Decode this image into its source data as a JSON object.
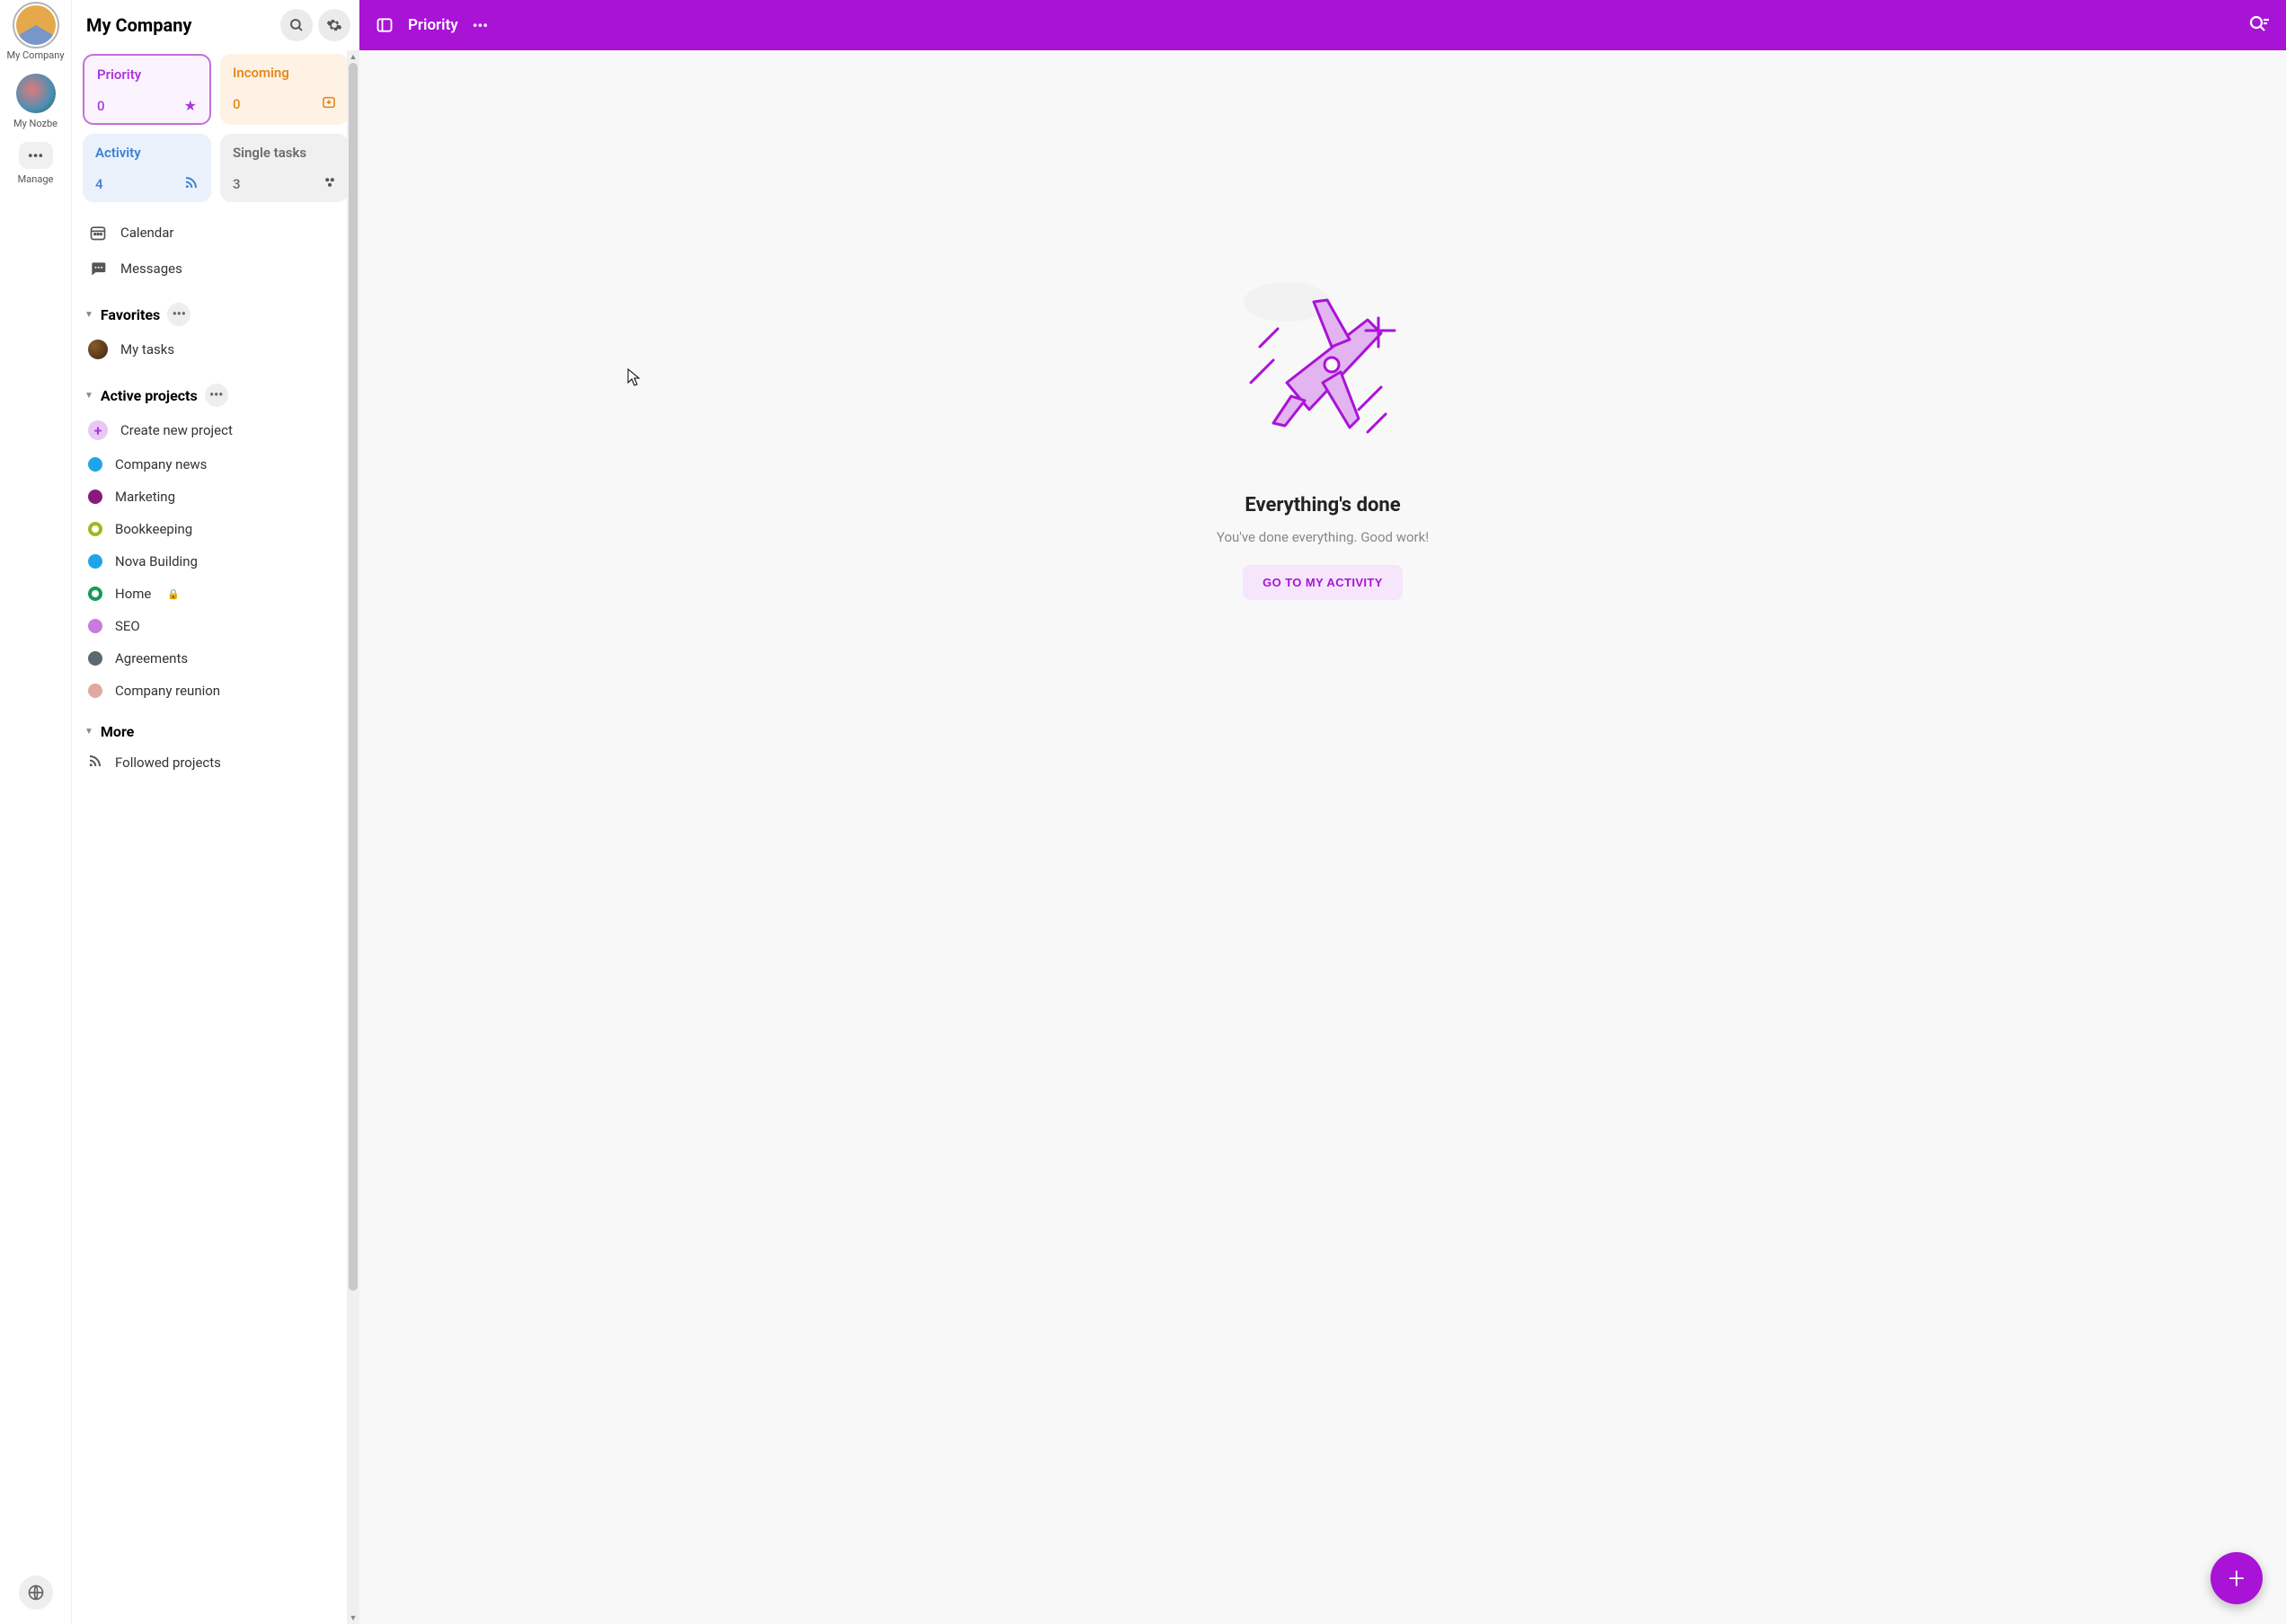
{
  "rail": {
    "workspaces": [
      {
        "label": "My Company",
        "selected": true,
        "bg": "conic-gradient(#e5a84a 0 120deg, #7797c9 120deg 240deg, #e5a84a 240deg)"
      },
      {
        "label": "My Nozbe",
        "selected": false,
        "bg": "radial-gradient(circle at 40% 40%, #e07a7a, #4a8fb5 60%, #2d5a3a)"
      }
    ],
    "manage_label": "Manage"
  },
  "sidebar": {
    "title": "My Company",
    "tiles": {
      "priority": {
        "title": "Priority",
        "count": "0"
      },
      "incoming": {
        "title": "Incoming",
        "count": "0"
      },
      "activity": {
        "title": "Activity",
        "count": "4"
      },
      "single": {
        "title": "Single tasks",
        "count": "3"
      }
    },
    "links": {
      "calendar": "Calendar",
      "messages": "Messages"
    },
    "favorites": {
      "title": "Favorites",
      "items": [
        {
          "label": "My tasks",
          "type": "avatar"
        }
      ]
    },
    "active_projects": {
      "title": "Active projects",
      "create_label": "Create new project",
      "items": [
        {
          "label": "Company news",
          "color": "#1fa4e8",
          "style": "dot"
        },
        {
          "label": "Marketing",
          "color": "#8a1a7a",
          "style": "dot"
        },
        {
          "label": "Bookkeeping",
          "color": "#a5b51f",
          "style": "ring"
        },
        {
          "label": "Nova Building",
          "color": "#1fa4e8",
          "style": "dot"
        },
        {
          "label": "Home",
          "color": "#159a5a",
          "style": "ring",
          "locked": true
        },
        {
          "label": "SEO",
          "color": "#c97be0",
          "style": "dot"
        },
        {
          "label": "Agreements",
          "color": "#5a6a6e",
          "style": "dot"
        },
        {
          "label": "Company reunion",
          "color": "#e0a9a0",
          "style": "dot"
        }
      ]
    },
    "more": {
      "title": "More",
      "followed_label": "Followed projects"
    }
  },
  "topbar": {
    "title": "Priority"
  },
  "empty": {
    "title": "Everything's done",
    "subtitle": "You've done everything. Good work!",
    "button": "GO TO MY ACTIVITY"
  },
  "colors": {
    "brand": "#a913d6"
  }
}
